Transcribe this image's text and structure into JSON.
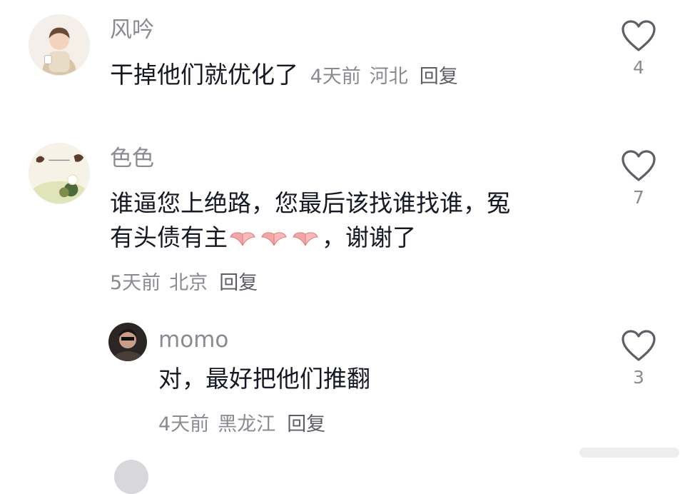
{
  "comments": [
    {
      "username": "风吟",
      "text": "干掉他们就优化了",
      "time": "4天前",
      "location": "河北",
      "reply_label": "回复",
      "likes": "4"
    },
    {
      "username": "色色",
      "text_line1": "谁逼您上绝路，您最后该找谁找谁，冤",
      "text_line2_prefix": "有头债有主",
      "text_line2_suffix": "，谢谢了",
      "emoji": "pray-hands",
      "emoji_count": 3,
      "time": "5天前",
      "location": "北京",
      "reply_label": "回复",
      "likes": "7"
    },
    {
      "username": "momo",
      "text": "对，最好把他们推翻",
      "time": "4天前",
      "location": "黑龙江",
      "reply_label": "回复",
      "likes": "3"
    }
  ],
  "colors": {
    "text_primary": "#161823",
    "text_secondary": "#8a8b91",
    "heart_stroke": "#5d5e66"
  },
  "icons": {
    "like": "heart-outline-icon",
    "emoji": "pray-hands-emoji"
  }
}
